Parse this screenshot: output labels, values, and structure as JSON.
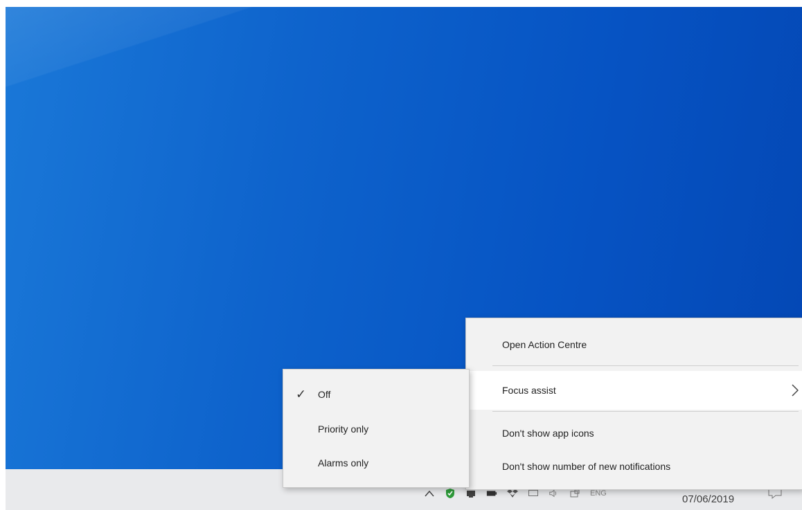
{
  "main_menu": {
    "items": [
      {
        "label": "Open Action Centre"
      },
      {
        "label": "Focus assist",
        "has_submenu": true
      },
      {
        "label": "Don't show app icons"
      },
      {
        "label": "Don't show number of new notifications"
      }
    ]
  },
  "focus_submenu": {
    "check_glyph": "✓",
    "items": [
      {
        "label": "Off",
        "checked": true
      },
      {
        "label": "Priority only",
        "checked": false
      },
      {
        "label": "Alarms only",
        "checked": false
      }
    ]
  },
  "taskbar": {
    "date": "07/06/2019",
    "lang": "ENG",
    "tray_icons": [
      "chevron-up-icon",
      "shield-icon",
      "network-adapter-icon",
      "battery-icon",
      "dropbox-icon",
      "display-icon",
      "volume-icon",
      "keyboard-icon"
    ]
  },
  "colors": {
    "desktop_blue": "#0653c3",
    "taskbar_bg": "#e9eaec",
    "menu_bg": "#f2f2f2",
    "menu_highlight": "#ffffff"
  }
}
